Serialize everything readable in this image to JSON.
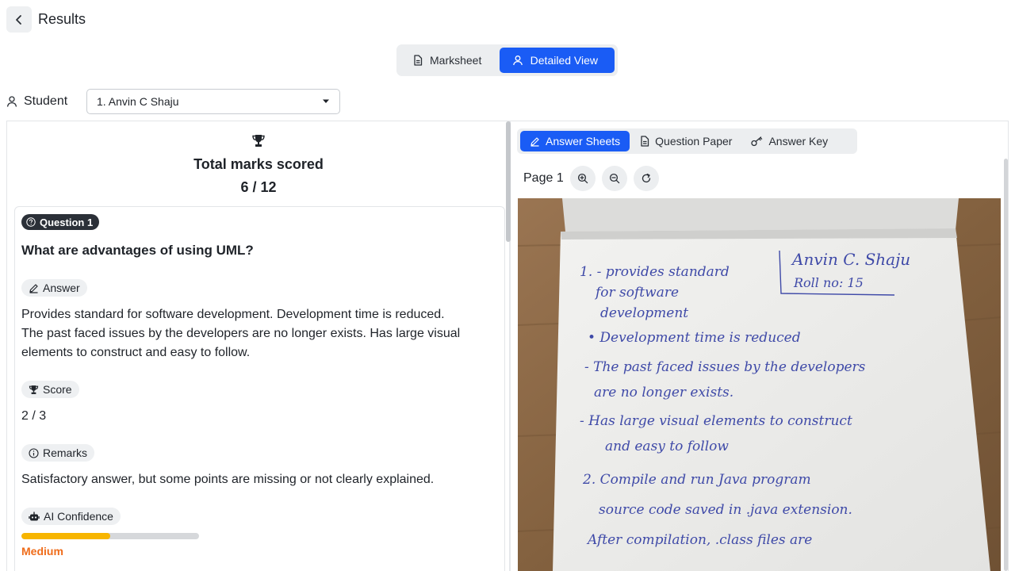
{
  "header": {
    "title": "Results"
  },
  "view_toggle": {
    "items": [
      {
        "label": "Marksheet"
      },
      {
        "label": "Detailed View"
      }
    ]
  },
  "student": {
    "label": "Student",
    "selected": "1. Anvin C Shaju"
  },
  "summary": {
    "title": "Total marks scored",
    "value": "6 / 12"
  },
  "question": {
    "badge": "Question 1",
    "text": "What are advantages of using UML?",
    "answer_label": "Answer",
    "answer_lines": [
      "Provides standard for software development. Development time is reduced.",
      "The past faced issues by the developers are no longer exists. Has large visual",
      "elements to construct and easy to follow."
    ],
    "score_label": "Score",
    "score": "2 / 3",
    "remarks_label": "Remarks",
    "remarks": "Satisfactory answer, but some points are missing or not clearly explained.",
    "confidence_label": "AI Confidence",
    "confidence_fraction": 0.5,
    "confidence_level": "Medium"
  },
  "viewer": {
    "tabs": [
      {
        "label": "Answer Sheets"
      },
      {
        "label": "Question Paper"
      },
      {
        "label": "Answer Key"
      }
    ],
    "page_label": "Page 1",
    "handwriting": {
      "name": "Anvin C. Shaju",
      "roll": "Roll no: 15",
      "lines": [
        "1. - provides standard",
        "for software",
        "development",
        "• Development time is reduced",
        "- The past faced issues by the developers",
        "are no longer exists.",
        "- Has large visual elements to construct",
        "and easy to follow",
        "2. Compile and run Java program",
        "source code saved in .java extension.",
        "After compilation, .class files are"
      ]
    }
  },
  "colors": {
    "accent": "#1a5cf5",
    "confidence_fill": "#f7b500",
    "confidence_text": "#ef6c1a"
  }
}
